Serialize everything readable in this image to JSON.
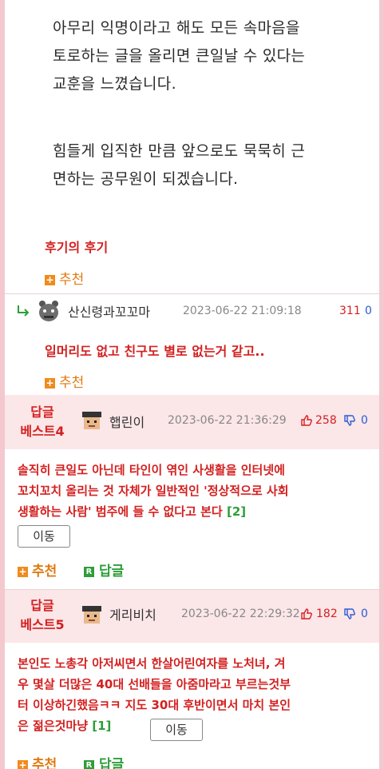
{
  "post": {
    "paragraph1": [
      "아무리 익명이라고 해도 모든 속마음을",
      "토로하는 글을 올리면 큰일날 수 있다는",
      "교훈을 느꼈습니다."
    ],
    "paragraph2": [
      "힘들게 입직한 만큼 앞으로도 묵묵히 근",
      "면하는 공무원이 되겠습니다."
    ],
    "title_link": "후기의 후기",
    "recommend_label": "추천"
  },
  "comments": [
    {
      "nick": "산신령과꼬꼬마",
      "date": "2023-06-22 21:09:18",
      "likes": "311",
      "dislikes": "0",
      "text": "일머리도 없고 친구도 별로 없는거 같고..",
      "recommend_label": "추천"
    }
  ],
  "best": [
    {
      "label_line1": "답글",
      "label_line2": "베스트4",
      "nick": "햅린이",
      "date": "2023-06-22 21:36:29",
      "likes": "258",
      "dislikes": "0",
      "text_lines": [
        "솔직히 큰일도 아닌데 타인이 엮인 사생활을 인터넷에",
        "꼬치꼬치 올리는 것 자체가 일반적인 '정상적으로 사회",
        "생활하는 사람' 범주에 들 수 없다고 본다"
      ],
      "reply_ref": "[2]",
      "move_label": "이동",
      "recommend_label": "추천",
      "reply_label": "답글"
    },
    {
      "label_line1": "답글",
      "label_line2": "베스트5",
      "nick": "게리비치",
      "date": "2023-06-22 22:29:32",
      "likes": "182",
      "dislikes": "0",
      "text_lines": [
        "본인도 노총각 아저씨면서 한살어린여자를 노처녀, 겨",
        "우 몇살 더많은 40대 선배들을 아줌마라고 부르는것부",
        "터 이상하긴했음ㅋㅋ 지도 30대 후반이면서 마치 본인",
        "은 젊은것마냥"
      ],
      "reply_ref": "[1]",
      "move_label": "이동",
      "recommend_label": "추천",
      "reply_label": "답글"
    }
  ],
  "colors": {
    "accent_red": "#d42020",
    "recommend_orange": "#e07a12",
    "reply_green": "#2e9e3a",
    "page_pink": "#f3c8ce",
    "band_pink": "#fbe6e8"
  },
  "icons": [
    "reply-arrow-icon",
    "plus-icon",
    "r-icon",
    "thumbs-up-icon",
    "thumbs-down-icon",
    "avatar-icon"
  ]
}
